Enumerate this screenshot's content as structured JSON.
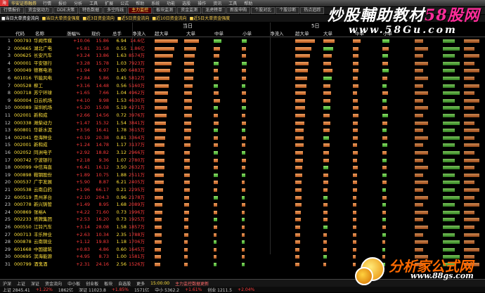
{
  "titlebar": {
    "logo": "海",
    "app": "华安证券融券",
    "menus": [
      "行情",
      "报价",
      "分析",
      "工具",
      "扩展",
      "公式",
      "帮助",
      "系统",
      "功能",
      "选股",
      "操作",
      "资讯",
      "工具",
      "帮助"
    ]
  },
  "tabs1": [
    {
      "label": "行情报价",
      "active": false
    },
    {
      "label": "资金驱动力",
      "active": false
    },
    {
      "label": "DDE决策",
      "active": false
    },
    {
      "label": "特色数据",
      "active": false
    },
    {
      "label": "多空阵线",
      "active": false
    },
    {
      "label": "主力监控",
      "active": true
    },
    {
      "label": "板块监测",
      "active": false
    },
    {
      "label": "资金监测",
      "active": false
    },
    {
      "label": "龙虎榜单",
      "active": false
    },
    {
      "label": "新股申购",
      "active": false
    },
    {
      "label": "个股对比",
      "active": false
    },
    {
      "label": "个股诊断",
      "active": false
    },
    {
      "label": "热点追踪",
      "active": false
    }
  ],
  "tabs2": [
    {
      "label": "■当日大单资金流向",
      "active": true
    },
    {
      "label": "■当日大单资金强度",
      "active": false
    },
    {
      "label": "■近3日资金流向",
      "active": false
    },
    {
      "label": "■近5日资金流向",
      "active": false
    },
    {
      "label": "■近10日资金流向",
      "active": false
    },
    {
      "label": "■近5日大单资金强度",
      "active": false
    }
  ],
  "groups": {
    "today": "当日",
    "five_day": "5日"
  },
  "columns": [
    "代码",
    "名称",
    "涨幅%",
    "现价",
    "总手",
    "净流入",
    "超大单",
    "大单",
    "中单",
    "小单",
    "净流入",
    "超大单",
    "大单",
    "中单",
    "小单"
  ],
  "rows": [
    {
      "idx": "1",
      "code": "000793",
      "name": "华闻传媒",
      "pct": "+10.06",
      "price": "15.86",
      "vol": "6.94",
      "flow": "14.6亿",
      "dir": "up",
      "t": [
        0.82,
        0.55,
        0.3,
        0.2
      ],
      "f": [
        0.78,
        0.4,
        0.28,
        0.22
      ]
    },
    {
      "idx": "2",
      "code": "000665",
      "name": "湖北广电",
      "pct": "+5.81",
      "price": "31.58",
      "vol": "0.55",
      "flow": "1.86亿",
      "dir": "up",
      "t": [
        0.7,
        0.44,
        0.24,
        0.18
      ],
      "f": [
        0.64,
        0.34,
        0.22,
        0.2
      ]
    },
    {
      "idx": "3",
      "code": "000625",
      "name": "长安汽车",
      "pct": "+3.24",
      "price": "13.86",
      "vol": "1.63",
      "flow": "8574万",
      "dir": "up",
      "t": [
        0.66,
        0.4,
        0.22,
        0.16
      ],
      "f": [
        0.58,
        0.3,
        0.2,
        0.18
      ]
    },
    {
      "idx": "4",
      "code": "000001",
      "name": "平安银行",
      "pct": "+3.28",
      "price": "15.78",
      "vol": "1.03",
      "flow": "7923万",
      "dir": "up",
      "t": [
        0.6,
        0.38,
        0.2,
        0.2
      ],
      "f": [
        0.52,
        0.28,
        0.22,
        0.18
      ]
    },
    {
      "idx": "5",
      "code": "000049",
      "name": "德赛电池",
      "pct": "+1.94",
      "price": "6.97",
      "vol": "1.00",
      "flow": "6483万",
      "dir": "up",
      "t": [
        0.56,
        0.36,
        0.18,
        0.16
      ],
      "f": [
        0.5,
        0.32,
        0.2,
        0.2
      ]
    },
    {
      "idx": "6",
      "code": "601016",
      "name": "节能风电",
      "pct": "+2.84",
      "price": "5.86",
      "vol": "0.45",
      "flow": "5812万",
      "dir": "up",
      "t": [
        0.52,
        0.34,
        0.2,
        0.18
      ],
      "f": [
        0.46,
        0.3,
        0.18,
        0.16
      ]
    },
    {
      "idx": "7",
      "code": "000528",
      "name": "柳工",
      "pct": "+3.16",
      "price": "14.48",
      "vol": "0.56",
      "flow": "5160万",
      "dir": "up",
      "t": [
        0.5,
        0.32,
        0.18,
        0.14
      ],
      "f": [
        0.44,
        0.26,
        0.2,
        0.14
      ]
    },
    {
      "idx": "8",
      "code": "000718",
      "name": "苏宁环球",
      "pct": "+1.65",
      "price": "7.66",
      "vol": "1.04",
      "flow": "4962万",
      "dir": "up",
      "t": [
        0.48,
        0.3,
        0.2,
        0.16
      ],
      "f": [
        0.42,
        0.28,
        0.16,
        0.18
      ]
    },
    {
      "idx": "9",
      "code": "600004",
      "name": "白云机场",
      "pct": "+4.10",
      "price": "9.98",
      "vol": "1.53",
      "flow": "4630万",
      "dir": "up",
      "t": [
        0.46,
        0.28,
        0.24,
        0.18
      ],
      "f": [
        0.4,
        0.26,
        0.18,
        0.14
      ]
    },
    {
      "idx": "10",
      "code": "000089",
      "name": "深圳机场",
      "pct": "+5.20",
      "price": "15.08",
      "vol": "5.19",
      "flow": "4271万",
      "dir": "up",
      "t": [
        0.44,
        0.3,
        0.18,
        0.16
      ],
      "f": [
        0.4,
        0.24,
        0.22,
        0.16
      ]
    },
    {
      "idx": "11",
      "code": "002001",
      "name": "新和成",
      "pct": "+2.66",
      "price": "14.56",
      "vol": "0.72",
      "flow": "3976万",
      "dir": "up",
      "t": [
        0.42,
        0.28,
        0.18,
        0.14
      ],
      "f": [
        0.38,
        0.22,
        0.2,
        0.18
      ]
    },
    {
      "idx": "12",
      "code": "000338",
      "name": "潍柴动力",
      "pct": "+1.47",
      "price": "15.32",
      "vol": "1.54",
      "flow": "3841万",
      "dir": "up",
      "t": [
        0.4,
        0.26,
        0.2,
        0.16
      ],
      "f": [
        0.36,
        0.24,
        0.18,
        0.16
      ]
    },
    {
      "idx": "13",
      "code": "600801",
      "name": "华新水泥",
      "pct": "+3.56",
      "price": "16.41",
      "vol": "1.78",
      "flow": "3615万",
      "dir": "up",
      "t": [
        0.4,
        0.26,
        0.16,
        0.14
      ],
      "f": [
        0.34,
        0.22,
        0.18,
        0.14
      ]
    },
    {
      "idx": "14",
      "code": "002041",
      "name": "登海种业",
      "pct": "+0.19",
      "price": "20.38",
      "vol": "0.81",
      "flow": "3364万",
      "dir": "up",
      "t": [
        0.38,
        0.24,
        0.18,
        0.16
      ],
      "f": [
        0.34,
        0.2,
        0.18,
        0.16
      ]
    },
    {
      "idx": "15",
      "code": "002001",
      "name": "新和成",
      "pct": "+1.24",
      "price": "14.78",
      "vol": "1.17",
      "flow": "3137万",
      "dir": "up",
      "t": [
        0.36,
        0.24,
        0.16,
        0.14
      ],
      "f": [
        0.32,
        0.22,
        0.16,
        0.16
      ]
    },
    {
      "idx": "16",
      "code": "002052",
      "name": "同洲电子",
      "pct": "+2.92",
      "price": "18.82",
      "vol": "3.12",
      "flow": "2966万",
      "dir": "up",
      "t": [
        0.36,
        0.22,
        0.18,
        0.14
      ],
      "f": [
        0.3,
        0.2,
        0.18,
        0.14
      ]
    },
    {
      "idx": "17",
      "code": "000742",
      "name": "宁波银行",
      "pct": "+2.18",
      "price": "9.36",
      "vol": "1.07",
      "flow": "2780万",
      "dir": "up",
      "t": [
        0.34,
        0.22,
        0.16,
        0.16
      ],
      "f": [
        0.3,
        0.2,
        0.16,
        0.14
      ]
    },
    {
      "idx": "18",
      "code": "000099",
      "name": "中信海直",
      "pct": "+6.41",
      "price": "16.12",
      "vol": "3.50",
      "flow": "2632万",
      "dir": "up",
      "t": [
        0.34,
        0.2,
        0.18,
        0.14
      ],
      "f": [
        0.28,
        0.18,
        0.18,
        0.14
      ]
    },
    {
      "idx": "19",
      "code": "000898",
      "name": "鞍钢股份",
      "pct": "+1.89",
      "price": "10.75",
      "vol": "1.88",
      "flow": "2511万",
      "dir": "up",
      "t": [
        0.32,
        0.2,
        0.16,
        0.14
      ],
      "f": [
        0.28,
        0.18,
        0.16,
        0.14
      ]
    },
    {
      "idx": "20",
      "code": "000537",
      "name": "广宇发展",
      "pct": "+5.90",
      "price": "8.87",
      "vol": "6.21",
      "flow": "2405万",
      "dir": "up",
      "t": [
        0.32,
        0.2,
        0.16,
        0.12
      ],
      "f": [
        0.26,
        0.18,
        0.16,
        0.14
      ]
    },
    {
      "idx": "21",
      "code": "000538",
      "name": "云南白药",
      "pct": "+1.96",
      "price": "66.17",
      "vol": "0.21",
      "flow": "2295万",
      "dir": "up",
      "t": [
        0.3,
        0.2,
        0.14,
        0.14
      ],
      "f": [
        0.26,
        0.16,
        0.16,
        0.12
      ]
    },
    {
      "idx": "22",
      "code": "600519",
      "name": "贵州茅台",
      "pct": "+2.10",
      "price": "204.3",
      "vol": "0.96",
      "flow": "2178万",
      "dir": "up",
      "t": [
        0.3,
        0.18,
        0.16,
        0.12
      ],
      "f": [
        0.24,
        0.16,
        0.14,
        0.14
      ]
    },
    {
      "idx": "23",
      "code": "000778",
      "name": "新兴铸管",
      "pct": "+1.49",
      "price": "8.95",
      "vol": "1.68",
      "flow": "2089万",
      "dir": "up",
      "t": [
        0.28,
        0.18,
        0.14,
        0.14
      ],
      "f": [
        0.24,
        0.16,
        0.14,
        0.12
      ]
    },
    {
      "idx": "24",
      "code": "000869",
      "name": "张裕A",
      "pct": "+4.22",
      "price": "71.60",
      "vol": "0.73",
      "flow": "1996万",
      "dir": "up",
      "t": [
        0.28,
        0.18,
        0.14,
        0.12
      ],
      "f": [
        0.22,
        0.14,
        0.14,
        0.12
      ]
    },
    {
      "idx": "25",
      "code": "002233",
      "name": "塔牌集团",
      "pct": "+2.53",
      "price": "16.20",
      "vol": "0.73",
      "flow": "1925万",
      "dir": "up",
      "t": [
        0.26,
        0.16,
        0.14,
        0.12
      ],
      "f": [
        0.22,
        0.14,
        0.14,
        0.12
      ]
    },
    {
      "idx": "26",
      "code": "000550",
      "name": "江铃汽车",
      "pct": "+3.14",
      "price": "28.08",
      "vol": "1.58",
      "flow": "1857万",
      "dir": "up",
      "t": [
        0.26,
        0.16,
        0.14,
        0.12
      ],
      "f": [
        0.2,
        0.14,
        0.12,
        0.12
      ]
    },
    {
      "idx": "27",
      "code": "000713",
      "name": "丰乐种业",
      "pct": "+2.63",
      "price": "10.34",
      "vol": "2.35",
      "flow": "1788万",
      "dir": "up",
      "t": [
        0.24,
        0.16,
        0.12,
        0.12
      ],
      "f": [
        0.2,
        0.12,
        0.12,
        0.12
      ]
    },
    {
      "idx": "28",
      "code": "000878",
      "name": "云南铜业",
      "pct": "+1.12",
      "price": "19.83",
      "vol": "1.18",
      "flow": "1706万",
      "dir": "up",
      "t": [
        0.24,
        0.14,
        0.12,
        0.12
      ],
      "f": [
        0.2,
        0.12,
        0.12,
        0.1
      ]
    },
    {
      "idx": "29",
      "code": "601668",
      "name": "中国建筑",
      "pct": "+0.83",
      "price": "4.86",
      "vol": "0.60",
      "flow": "1645万",
      "dir": "up",
      "t": [
        0.22,
        0.14,
        0.12,
        0.1
      ],
      "f": [
        0.18,
        0.12,
        0.12,
        0.1
      ]
    },
    {
      "idx": "30",
      "code": "000695",
      "name": "滨海能源",
      "pct": "+4.95",
      "price": "8.73",
      "vol": "1.00",
      "flow": "1581万",
      "dir": "up",
      "t": [
        0.22,
        0.14,
        0.12,
        0.1
      ],
      "f": [
        0.18,
        0.12,
        0.1,
        0.1
      ]
    },
    {
      "idx": "31",
      "code": "000799",
      "name": "酒鬼酒",
      "pct": "+2.31",
      "price": "24.16",
      "vol": "2.56",
      "flow": "1526万",
      "dir": "up",
      "t": [
        0.2,
        0.14,
        0.1,
        0.1
      ],
      "f": [
        0.18,
        0.1,
        0.1,
        0.1
      ]
    }
  ],
  "statusbar": {
    "items": [
      "沪深",
      "上证",
      "深证",
      "资金流向",
      "中小板",
      "创业板",
      "板块",
      "自选股",
      "更多"
    ],
    "time": "15:00:00",
    "alert": "主力监控数据更新"
  },
  "bottombar": {
    "items": [
      "上证 2845.41",
      "+1.22%",
      "1862亿",
      "深证 11023.8",
      "+1.85%",
      "1571亿",
      "中小 5362.2",
      "+1.61%",
      "创业 1211.5",
      "+2.04%"
    ]
  },
  "watermarks": {
    "top": "炒股輔助教材",
    "top_brand": "58股网",
    "url": "www.58Gu.com",
    "bottom": "分析家公式网",
    "bottom_url": "www.88gs.com"
  },
  "colors": {
    "up": "#ff3b3b",
    "down": "#34d23a",
    "accent": "#ffe13b"
  }
}
